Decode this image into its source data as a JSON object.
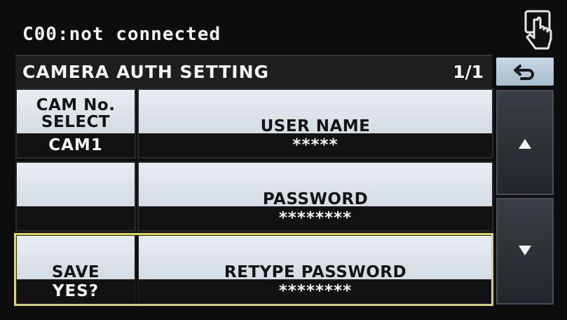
{
  "status": {
    "text": "C00:not connected",
    "touch_icon": "touch-hand-icon"
  },
  "header": {
    "title": "CAMERA AUTH SETTING",
    "page": "1/1",
    "back_icon": "back-arrow-icon"
  },
  "rows": [
    {
      "left_label": "CAM No.\nSELECT",
      "left_value": "CAM1",
      "right_label": "USER NAME",
      "right_value": "*****"
    },
    {
      "left_label": "",
      "left_value": "",
      "right_label": "PASSWORD",
      "right_value": "********"
    },
    {
      "left_label": "SAVE",
      "left_value": "YES?",
      "right_label": "RETYPE PASSWORD",
      "right_value": "********"
    }
  ],
  "scroll": {
    "up_icon": "arrow-up-icon",
    "down_icon": "arrow-down-icon"
  },
  "colors": {
    "highlight": "#dcd46a",
    "cell": "#dde5ec",
    "value_bar": "#121212"
  }
}
